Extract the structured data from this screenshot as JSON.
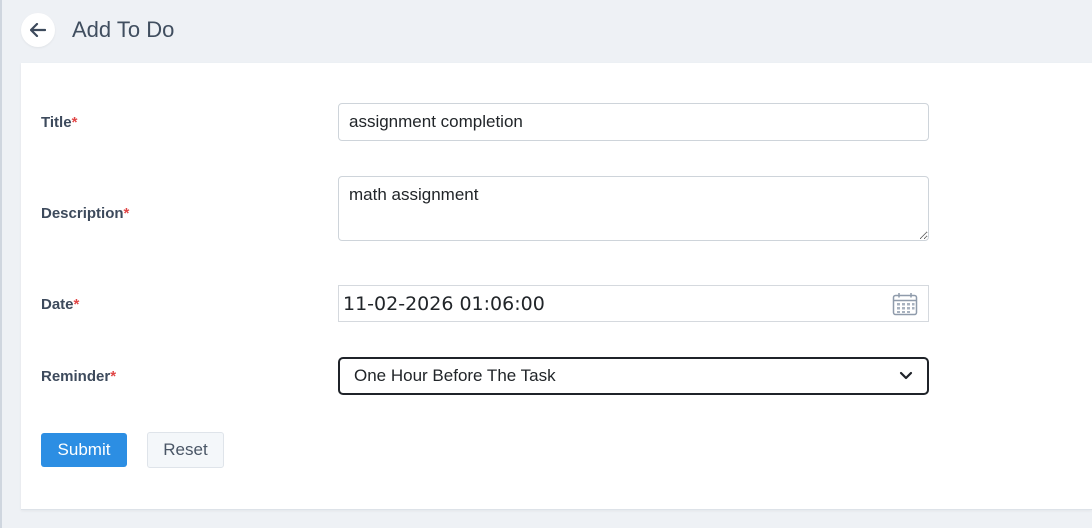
{
  "header": {
    "back_icon": "arrow-left-icon",
    "title": "Add To Do"
  },
  "form": {
    "required_marker": "*",
    "title": {
      "label": "Title",
      "value": "assignment completion"
    },
    "description": {
      "label": "Description",
      "value": "math assignment"
    },
    "date": {
      "label": "Date",
      "value": "11-02-2026 01:06:00",
      "icon": "calendar-icon"
    },
    "reminder": {
      "label": "Reminder",
      "selected": "One Hour Before The Task",
      "icon": "chevron-down-icon"
    }
  },
  "actions": {
    "submit_label": "Submit",
    "reset_label": "Reset"
  },
  "colors": {
    "primary": "#2c8ee3",
    "required": "#e04646",
    "background": "#eef1f5"
  }
}
